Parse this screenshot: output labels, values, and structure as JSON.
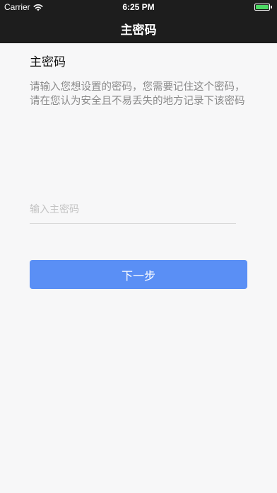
{
  "status_bar": {
    "carrier": "Carrier",
    "time": "6:25 PM",
    "battery_color": "#4cd964"
  },
  "nav_bar": {
    "title": "主密码"
  },
  "main": {
    "section_title": "主密码",
    "description": "请输入您想设置的密码，您需要记住这个密码，请在您认为安全且不易丢失的地方记录下该密码",
    "input_placeholder": "输入主密码",
    "input_value": "",
    "next_button_label": "下一步",
    "accent_color": "#5a8ff5"
  }
}
